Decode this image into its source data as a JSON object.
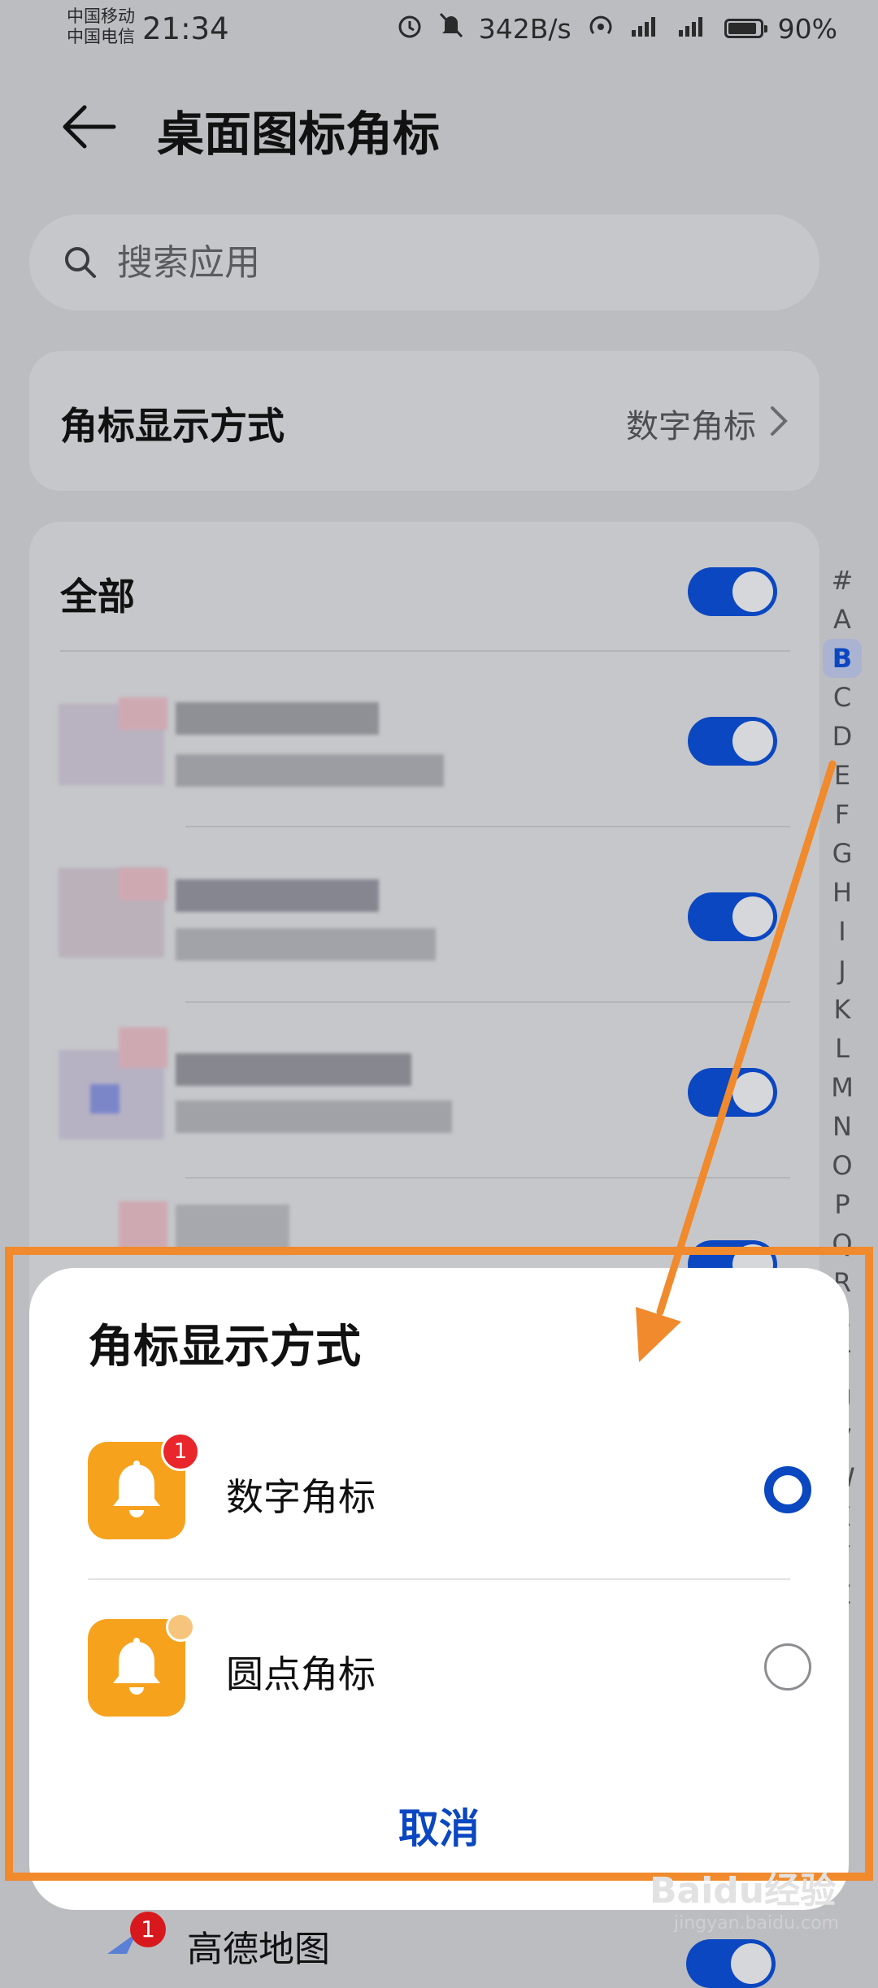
{
  "status_bar": {
    "carrier1": "中国移动",
    "carrier2": "中国电信",
    "time": "21:34",
    "net_speed": "342B/s",
    "battery_percent": "90%",
    "battery_level": 0.9
  },
  "header": {
    "title": "桌面图标角标"
  },
  "search": {
    "placeholder": "搜索应用"
  },
  "badge_style": {
    "label": "角标显示方式",
    "value": "数字角标"
  },
  "app_list": {
    "all_label": "全部",
    "all_enabled": true,
    "visible_bottom_item": {
      "name": "高德地图",
      "badge": "1"
    }
  },
  "alphabet_index": {
    "letters": [
      "#",
      "A",
      "B",
      "C",
      "D",
      "E",
      "F",
      "G",
      "H",
      "I",
      "J",
      "K",
      "L",
      "M",
      "N",
      "O",
      "P",
      "Q",
      "R",
      "S",
      "T",
      "U",
      "V",
      "W",
      "X",
      "Y",
      "Z"
    ],
    "selected": "B"
  },
  "sheet": {
    "title": "角标显示方式",
    "options": [
      {
        "label": "数字角标",
        "badge": "1",
        "selected": true
      },
      {
        "label": "圆点角标",
        "selected": false
      }
    ],
    "cancel_label": "取消"
  },
  "watermark": {
    "brand": "Baidu经验",
    "url": "jingyan.baidu.com"
  },
  "colors": {
    "accent": "#0b47c0",
    "app_icon": "#f6a21d",
    "badge_red": "#e8262b",
    "annotation_orange": "#f08a2c"
  }
}
